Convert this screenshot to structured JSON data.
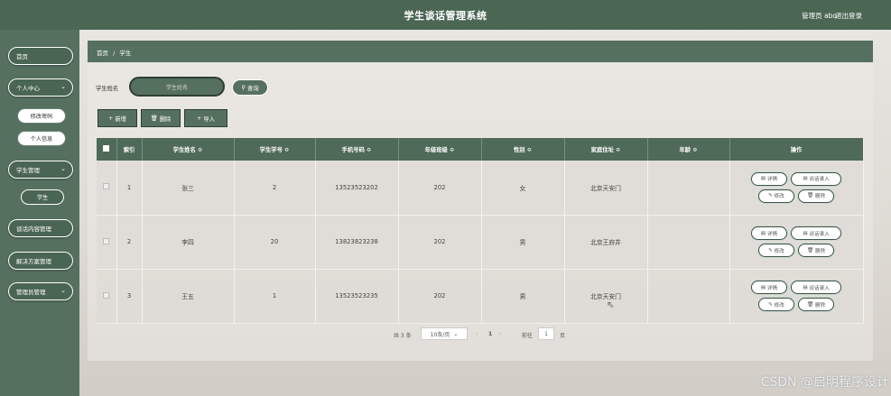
{
  "header": {
    "title": "学生谈话管理系统",
    "admin": "管理员 abo",
    "logout": "退出登录"
  },
  "sidebar": {
    "home": "首页",
    "personal_center": "个人中心",
    "change_password": "修改密码",
    "personal_info": "个人信息",
    "student_mgmt": "学生管理",
    "student": "学生",
    "talk_content_mgmt": "谈话内容管理",
    "solution_mgmt": "解决方案管理",
    "admin_mgmt": "管理员管理"
  },
  "breadcrumb": {
    "home": "首页",
    "sep": "/",
    "current": "学生"
  },
  "search": {
    "label": "学生姓名",
    "placeholder": "学生姓名",
    "query_button": "查询"
  },
  "toolbar": {
    "add": "新增",
    "delete": "删除",
    "import": "导入"
  },
  "table": {
    "headers": [
      "索引",
      "学生姓名 ≎",
      "学生学号 ≎",
      "手机号码 ≎",
      "年级班级 ≎",
      "性别 ≎",
      "家庭住址 ≎",
      "年龄 ≎",
      "操作"
    ],
    "rows": [
      {
        "index": "1",
        "name": "张三",
        "id": "2",
        "phone": "13523523202",
        "class": "202",
        "gender": "女",
        "address": "北京天安门",
        "age": ""
      },
      {
        "index": "2",
        "name": "李四",
        "id": "20",
        "phone": "13823823238",
        "class": "202",
        "gender": "男",
        "address": "北京王府井",
        "age": ""
      },
      {
        "index": "3",
        "name": "王五",
        "id": "1",
        "phone": "13523523235",
        "class": "202",
        "gender": "男",
        "address": "北京天安门",
        "age": ""
      }
    ],
    "actions": {
      "detail": "详情",
      "talk_entry": "谈话录入",
      "edit": "修改",
      "delete": "删除"
    }
  },
  "pagination": {
    "total": "共 3 条",
    "page_size": "10条/页",
    "current_page": "1",
    "goto_label": "前往",
    "goto_value": "1",
    "page_suffix": "页"
  },
  "watermark": "CSDN @启明程序设计"
}
